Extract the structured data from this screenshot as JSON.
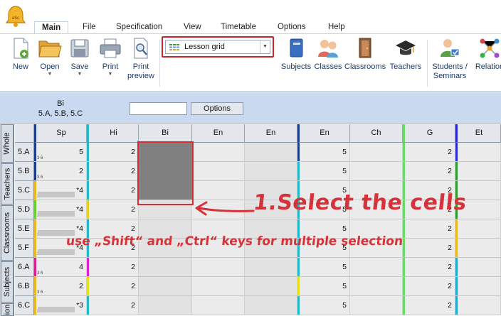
{
  "menu": {
    "tabs": [
      "Main",
      "File",
      "Specification",
      "View",
      "Timetable",
      "Options",
      "Help"
    ]
  },
  "ribbon": {
    "new": "New",
    "open": "Open",
    "save": "Save",
    "print": "Print",
    "print_preview_1": "Print",
    "print_preview_2": "preview",
    "view_select": "Lesson grid",
    "subjects": "Subjects",
    "classes": "Classes",
    "classrooms": "Classrooms",
    "teachers": "Teachers",
    "students_1": "Students /",
    "students_2": "Seminars",
    "relations": "Relation"
  },
  "filter": {
    "card_title_1": "Bi",
    "card_title_2": "5.A, 5.B, 5.C",
    "input_value": "",
    "options_label": "Options"
  },
  "side_tabs": [
    "Whole",
    "Teachers",
    "Classrooms",
    "Subjects",
    "ion"
  ],
  "columns": [
    "Sp",
    "Hi",
    "Bi",
    "En",
    "En",
    "En",
    "Ch",
    "G",
    "Et"
  ],
  "rows": [
    {
      "label": "5.A",
      "sub": "3 6",
      "Sp": "5",
      "Hi": "2",
      "En3": "5",
      "G": "2"
    },
    {
      "label": "5.B",
      "sub": "3 6",
      "Sp": "2",
      "Hi": "2",
      "En3": "5",
      "G": "2"
    },
    {
      "label": "5.C",
      "sub": "3 6",
      "Sp": "*4",
      "Hi": "2",
      "En3": "5",
      "G": "2"
    },
    {
      "label": "5.D",
      "sub": "3 6",
      "Sp": "*4",
      "Hi": "2",
      "En3": "5",
      "G": "2"
    },
    {
      "label": "5.E",
      "sub": "3 6",
      "Sp": "*4",
      "Hi": "2",
      "En3": "5",
      "G": "2"
    },
    {
      "label": "5.F",
      "sub": "3 6",
      "Sp": "*4",
      "Hi": "2",
      "En3": "5",
      "G": "2"
    },
    {
      "label": "6.A",
      "sub": "3 6",
      "Sp": "4",
      "Hi": "2",
      "En3": "5",
      "G": "2"
    },
    {
      "label": "6.B",
      "sub": "3 6",
      "Sp": "2",
      "Hi": "2",
      "En3": "5",
      "G": "2"
    },
    {
      "label": "6.C",
      "sub": "3 6",
      "Sp": "*3",
      "Hi": "2",
      "En3": "5",
      "G": "2"
    }
  ],
  "annotation": {
    "title": "1.Select the cells",
    "subtitle": "use „Shift“ and „Ctrl“ keys for multiple selection"
  },
  "colors": {
    "accent_red": "#d6323a",
    "filter_bg": "#c9daf0",
    "selection": "#808080"
  },
  "icons": [
    "app-bell-icon",
    "new-document-icon",
    "open-folder-icon",
    "save-disk-icon",
    "printer-icon",
    "print-preview-icon",
    "subjects-book-icon",
    "classes-students-icon",
    "classroom-door-icon",
    "teacher-cap-icon",
    "students-seminars-icon",
    "relations-network-icon",
    "grid-view-icon"
  ]
}
